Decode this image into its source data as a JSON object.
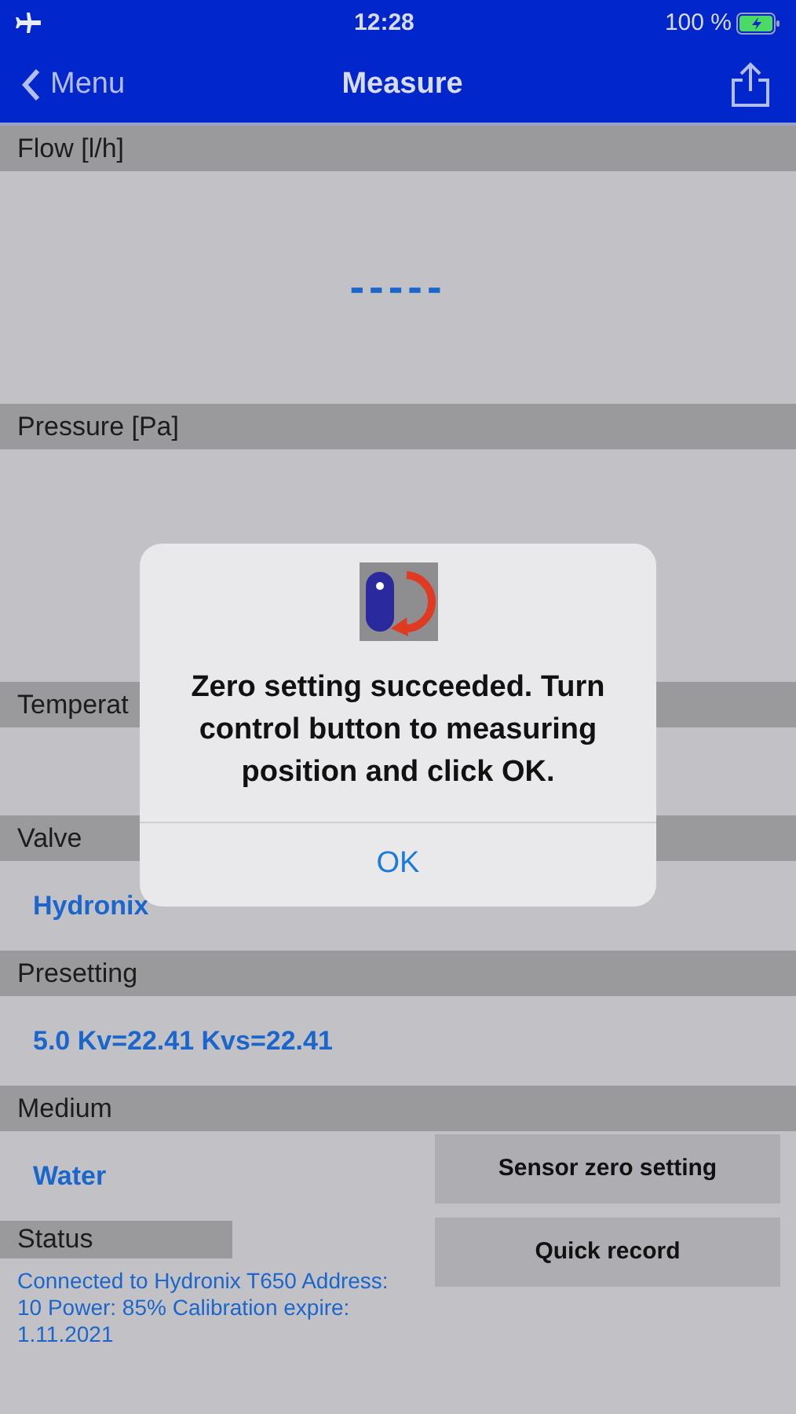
{
  "status_bar": {
    "time": "12:28",
    "battery": "100 %"
  },
  "nav": {
    "back": "Menu",
    "title": "Measure"
  },
  "sections": [
    {
      "kind": "reading",
      "header": "Flow [l/h]",
      "value": "-----"
    },
    {
      "kind": "blank",
      "header": "Pressure [Pa]"
    },
    {
      "kind": "short",
      "header": "Temperat"
    },
    {
      "kind": "link",
      "header": "Valve",
      "value": "Hydronix"
    },
    {
      "kind": "link",
      "header": "Presetting",
      "value": "5.0 Kv=22.41 Kvs=22.41"
    }
  ],
  "medium": {
    "header": "Medium",
    "value": "Water"
  },
  "status": {
    "header": "Status",
    "lines": "Connected to Hydronix T650 Address: 10 Power: 85% Calibration expire: 1.11.2021"
  },
  "buttons": [
    "Sensor zero setting",
    "Quick record"
  ],
  "alert": {
    "message": "Zero setting succeeded. Turn control button to measuring position and click OK.",
    "button": "OK"
  }
}
